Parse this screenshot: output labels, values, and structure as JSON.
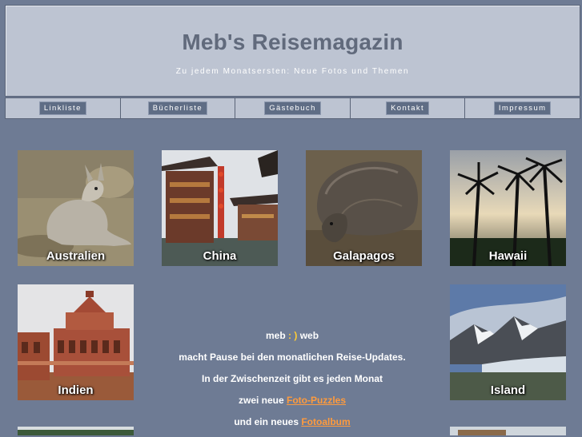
{
  "header": {
    "title": "Meb's Reisemagazin",
    "subtitle": "Zu jedem Monatsersten: Neue Fotos und Themen"
  },
  "nav": [
    {
      "label": "Linkliste"
    },
    {
      "label": "Bücherliste"
    },
    {
      "label": "Gästebuch"
    },
    {
      "label": "Kontakt"
    },
    {
      "label": "Impressum"
    }
  ],
  "tiles": {
    "australien": "Australien",
    "china": "China",
    "galapagos": "Galapagos",
    "hawaii": "Hawaii",
    "indien": "Indien",
    "island": "Island"
  },
  "message": {
    "brand_pre": "meb",
    "brand_smiley": ":",
    "brand_smiley2": ")",
    "brand_post": "web",
    "line2": "macht Pause bei den monatlichen Reise-Updates.",
    "line3": "In der Zwischenzeit gibt es jeden Monat",
    "line4_pre": "zwei neue",
    "line4_link": "Foto-Puzzles",
    "line5_pre": "und ein neues",
    "line5_link": "Fotoalbum"
  },
  "colors": {
    "page_bg": "#6e7b94",
    "header_bg": "#bdc4d2",
    "title": "#616a7c",
    "link": "#ff9b3d"
  }
}
